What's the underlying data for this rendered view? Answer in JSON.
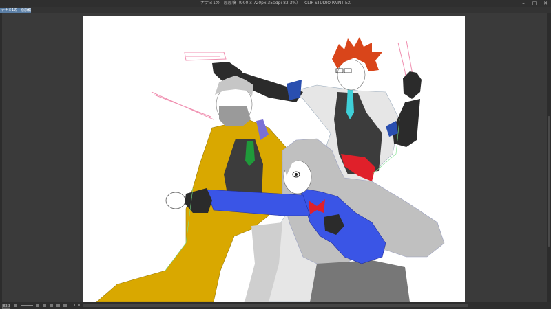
{
  "window": {
    "title": "ナナミ1の　原原稿（900 x 720px 350dpi 83.3%） - CLIP STUDIO PAINT EX",
    "minimize": "–",
    "maximize": "□",
    "close": "✕"
  },
  "tabs": [
    {
      "label": "ナナミ1の　原原稿",
      "close": "✕"
    }
  ],
  "status": {
    "zoom": "83.3",
    "coords": "0.0"
  },
  "colors": {
    "yellow_suit": "#d9a800",
    "blue_jacket": "#3a55e6",
    "hair_gray": "#b8b8b8",
    "red_hair": "#d9451a",
    "vest": "#3c3c3c",
    "glove": "#2b2b2b",
    "glove_blue": "#2a4fb0",
    "teal_tie": "#3fd0d8",
    "green_tie": "#1f9a3a",
    "red_ribbon": "#e0202a"
  }
}
